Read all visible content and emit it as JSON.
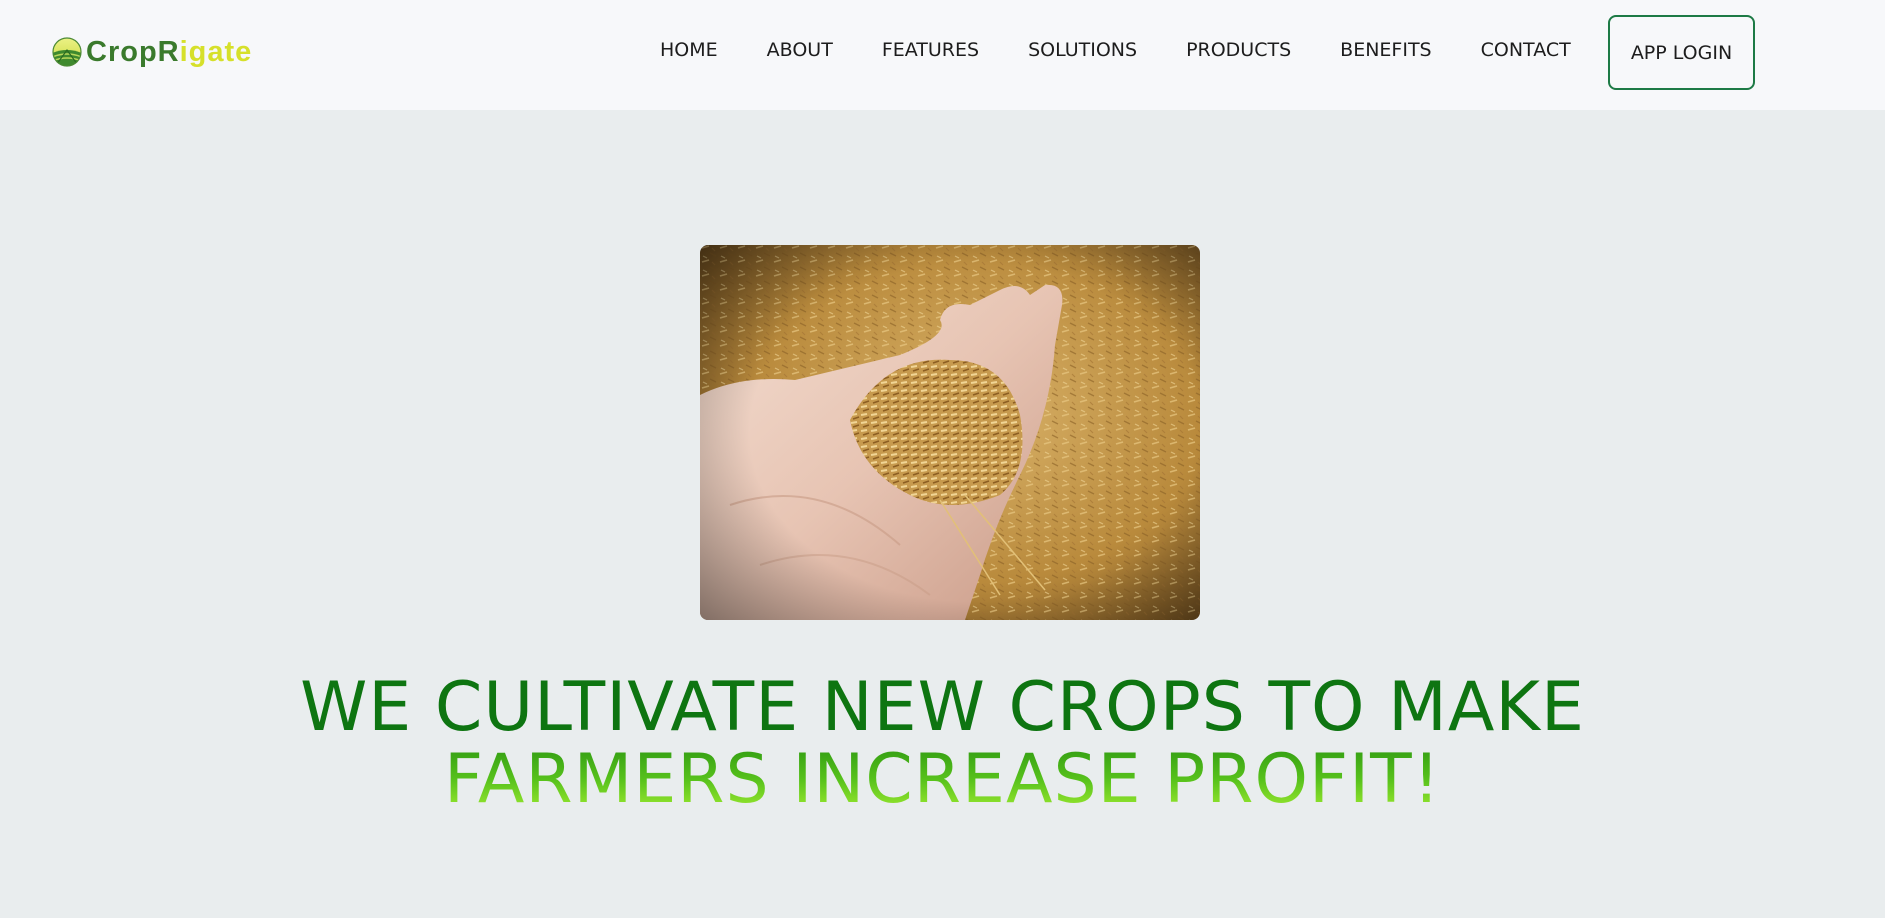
{
  "brand": {
    "name_part1": "CropR",
    "name_part2": "igate",
    "logo_icon": "farm-field-globe-icon",
    "colors": {
      "primary_green": "#3a7a2c",
      "accent_yellow": "#d6e02a"
    }
  },
  "nav": {
    "items": [
      {
        "label": "HOME"
      },
      {
        "label": "ABOUT"
      },
      {
        "label": "FEATURES"
      },
      {
        "label": "SOLUTIONS"
      },
      {
        "label": "PRODUCTS"
      },
      {
        "label": "BENEFITS"
      },
      {
        "label": "CONTACT"
      }
    ],
    "login_label": "APP LOGIN",
    "login_border_color": "#1d7a45"
  },
  "hero": {
    "image_subject": "hand-holding-grain-photo",
    "headline_line1": "WE CULTIVATE NEW CROPS TO MAKE",
    "headline_line2": "FARMERS INCREASE PROFIT!",
    "colors": {
      "line1": "#0e7511",
      "line2_top": "#2f9a12",
      "line2_bottom": "#a6ef33"
    }
  }
}
